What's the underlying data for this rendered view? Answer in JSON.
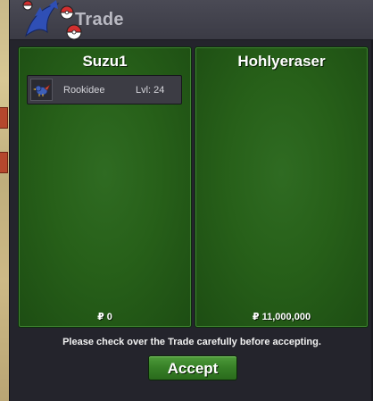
{
  "window": {
    "title": "Trade",
    "logo_icon": "pokeball-logo-icon"
  },
  "left_panel": {
    "player_name": "Suzu1",
    "items": [
      {
        "icon": "rookidee-icon",
        "name": "Rookidee",
        "level": "Lvl: 24"
      }
    ],
    "money": "₽ 0"
  },
  "right_panel": {
    "player_name": "Hohlyeraser",
    "items": [],
    "money": "₽ 11,000,000"
  },
  "footer": {
    "notice": "Please check over the Trade carefully before accepting.",
    "accept_label": "Accept"
  },
  "colors": {
    "panel_green": "#276019",
    "accept_green": "#367f26",
    "window_bg": "#24242c"
  }
}
